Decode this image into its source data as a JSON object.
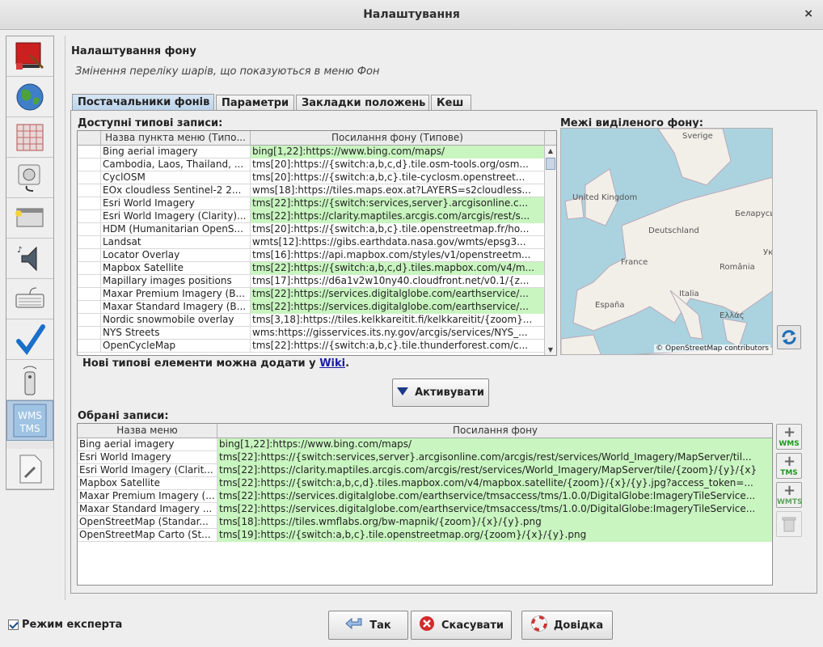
{
  "window": {
    "title": "Налаштування",
    "close_label": "×"
  },
  "sidebar": {
    "items": [
      {
        "name": "display-settings",
        "icon": "paint-brush-icon"
      },
      {
        "name": "map-settings",
        "icon": "globe-icon"
      },
      {
        "name": "projection-settings",
        "icon": "grid-icon"
      },
      {
        "name": "connection-settings",
        "icon": "plug-icon"
      },
      {
        "name": "remote-control-settings",
        "icon": "window-icon"
      },
      {
        "name": "audio-settings",
        "icon": "speaker-icon"
      },
      {
        "name": "keyboard-shortcuts",
        "icon": "keyboard-icon"
      },
      {
        "name": "validator-settings",
        "icon": "checkmark-icon"
      },
      {
        "name": "remote-settings",
        "icon": "remote-control-icon"
      },
      {
        "name": "imagery-settings",
        "icon": "wms-tms-icon",
        "label1": "WMS",
        "label2": "TMS"
      },
      {
        "name": "advanced-settings",
        "icon": "wrench-document-icon"
      }
    ]
  },
  "main": {
    "heading": "Налаштування фону",
    "description": "Змінення переліку шарів, що показуються в меню Фон",
    "tabs": [
      {
        "label": "Постачальники фонів",
        "active": true
      },
      {
        "label": "Параметри",
        "active": false
      },
      {
        "label": "Закладки положень",
        "active": false
      },
      {
        "label": "Кеш",
        "active": false
      }
    ],
    "available": {
      "label": "Доступні типові записи:",
      "columns": [
        "",
        "Назва пункта меню (Типо...",
        "Посилання фону (Типове)"
      ],
      "rows": [
        {
          "name": "Bing aerial imagery",
          "url": "bing[1,22]:https://www.bing.com/maps/",
          "selected": true
        },
        {
          "name": "Cambodia, Laos, Thailand, ...",
          "url": "tms[20]:https://{switch:a,b,c,d}.tile.osm-tools.org/osm...",
          "selected": false
        },
        {
          "name": "CyclOSM",
          "url": "tms[20]:https://{switch:a,b,c}.tile-cyclosm.openstreet...",
          "selected": false
        },
        {
          "name": "EOx cloudless Sentinel-2 2...",
          "url": "wms[18]:https://tiles.maps.eox.at?LAYERS=s2cloudless...",
          "selected": false
        },
        {
          "name": "Esri World Imagery",
          "url": "tms[22]:https://{switch:services,server}.arcgisonline.c...",
          "selected": true
        },
        {
          "name": "Esri World Imagery (Clarity)...",
          "url": "tms[22]:https://clarity.maptiles.arcgis.com/arcgis/rest/s...",
          "selected": true
        },
        {
          "name": "HDM (Humanitarian OpenS...",
          "url": "tms[20]:https://{switch:a,b,c}.tile.openstreetmap.fr/ho...",
          "selected": false
        },
        {
          "name": "Landsat",
          "url": "wmts[12]:https://gibs.earthdata.nasa.gov/wmts/epsg3...",
          "selected": false
        },
        {
          "name": "Locator Overlay",
          "url": "tms[16]:https://api.mapbox.com/styles/v1/openstreetm...",
          "selected": false
        },
        {
          "name": "Mapbox Satellite",
          "url": "tms[22]:https://{switch:a,b,c,d}.tiles.mapbox.com/v4/m...",
          "selected": true
        },
        {
          "name": "Mapillary images positions",
          "url": "tms[17]:https://d6a1v2w10ny40.cloudfront.net/v0.1/{z...",
          "selected": false
        },
        {
          "name": "Maxar Premium Imagery (B...",
          "url": "tms[22]:https://services.digitalglobe.com/earthservice/...",
          "selected": true
        },
        {
          "name": "Maxar Standard Imagery (B...",
          "url": "tms[22]:https://services.digitalglobe.com/earthservice/...",
          "selected": true
        },
        {
          "name": "Nordic snowmobile overlay",
          "url": "tms[3,18]:https://tiles.kelkkareitit.fi/kelkkareitit/{zoom}...",
          "selected": false
        },
        {
          "name": "NYS Streets",
          "url": "wms:https://gisservices.its.ny.gov/arcgis/services/NYS_...",
          "selected": false
        },
        {
          "name": "OpenCycleMap",
          "url": "tms[22]:https://{switch:a,b,c}.tile.thunderforest.com/c...",
          "selected": false
        }
      ]
    },
    "bounds_label": "Межі виділеного фону:",
    "map": {
      "labels": [
        "Sverige",
        "United Kingdom",
        "Беларусь",
        "Deutschland",
        "France",
        "Україна",
        "România",
        "Italia",
        "España",
        "Ελλάς"
      ],
      "attribution": "© OpenStreetMap contributors"
    },
    "wiki_note": {
      "text": "Нові типові елементи можна додати у ",
      "link": "Wiki",
      "suffix": "."
    },
    "activate_button": "Активувати",
    "selected": {
      "label": "Обрані записи:",
      "columns": [
        "Назва меню",
        "Посилання фону"
      ],
      "rows": [
        {
          "name": "Bing aerial imagery",
          "url": "bing[1,22]:https://www.bing.com/maps/"
        },
        {
          "name": "Esri World Imagery",
          "url": "tms[22]:https://{switch:services,server}.arcgisonline.com/arcgis/rest/services/World_Imagery/MapServer/til..."
        },
        {
          "name": "Esri World Imagery (Clarit...",
          "url": "tms[22]:https://clarity.maptiles.arcgis.com/arcgis/rest/services/World_Imagery/MapServer/tile/{zoom}/{y}/{x}"
        },
        {
          "name": "Mapbox Satellite",
          "url": "tms[22]:https://{switch:a,b,c,d}.tiles.mapbox.com/v4/mapbox.satellite/{zoom}/{x}/{y}.jpg?access_token=..."
        },
        {
          "name": "Maxar Premium Imagery (...",
          "url": "tms[22]:https://services.digitalglobe.com/earthservice/tmsaccess/tms/1.0.0/DigitalGlobe:ImageryTileService..."
        },
        {
          "name": "Maxar Standard Imagery ...",
          "url": "tms[22]:https://services.digitalglobe.com/earthservice/tmsaccess/tms/1.0.0/DigitalGlobe:ImageryTileService..."
        },
        {
          "name": "OpenStreetMap (Standar...",
          "url": "tms[18]:https://tiles.wmflabs.org/bw-mapnik/{zoom}/{x}/{y}.png"
        },
        {
          "name": "OpenStreetMap Carto (St...",
          "url": "tms[19]:https://{switch:a,b,c}.tile.openstreetmap.org/{zoom}/{x}/{y}.png"
        }
      ]
    },
    "side_buttons": [
      {
        "name": "add-wms-button",
        "tag": "WMS"
      },
      {
        "name": "add-tms-button",
        "tag": "TMS"
      },
      {
        "name": "add-wmts-button",
        "tag": "WMTS"
      },
      {
        "name": "delete-entry-button",
        "tag": ""
      }
    ]
  },
  "footer": {
    "expert_mode": {
      "label": "Режим експерта",
      "checked": true
    },
    "ok": "Так",
    "cancel": "Скасувати",
    "help": "Довідка"
  },
  "colors": {
    "selected_row": "#c9f5c0",
    "active_tab": "#b9d2ea",
    "link": "#1a1aa8"
  }
}
